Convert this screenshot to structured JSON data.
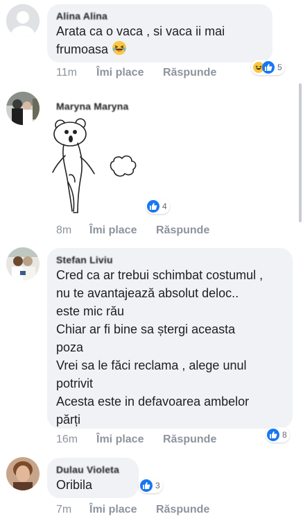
{
  "comments": [
    {
      "name": "Alina Alina",
      "lines": [
        "Arata ca o vaca , si vaca ii mai",
        "frumoasa"
      ],
      "time": "11m",
      "like_label": "Îmi place",
      "reply_label": "Răspunde",
      "reaction_count": "5",
      "reactions": [
        "haha-icon",
        "like-icon"
      ]
    },
    {
      "name": "Maryna Maryna",
      "sticker": "bear-sticker",
      "time": "8m",
      "like_label": "Îmi place",
      "reply_label": "Răspunde",
      "reaction_count": "4",
      "reactions": [
        "like-icon"
      ]
    },
    {
      "name": "Stefan Liviu",
      "lines": [
        "Cred ca ar trebui schimbat costumul ,",
        "nu te avantajează absolut deloc..",
        "este mic rău",
        "Chiar ar fi bine sa ștergi aceasta",
        "poza",
        "Vrei sa le făci reclama , alege unul",
        "potrivit",
        "Acesta este in defavoarea ambelor",
        "părți"
      ],
      "time": "16m",
      "like_label": "Îmi place",
      "reply_label": "Răspunde",
      "reaction_count": "8",
      "reactions": [
        "like-icon"
      ]
    },
    {
      "name": "Dulau Violeta",
      "lines": [
        "Oribila"
      ],
      "time": "7m",
      "like_label": "Îmi place",
      "reply_label": "Răspunde",
      "reaction_count": "3",
      "reactions": [
        "like-icon"
      ]
    }
  ],
  "colors": {
    "bubble": "#f0f2f5",
    "action_text": "#8d949e",
    "like_blue": "#1877f2",
    "haha_yellow": "#f7c746"
  }
}
